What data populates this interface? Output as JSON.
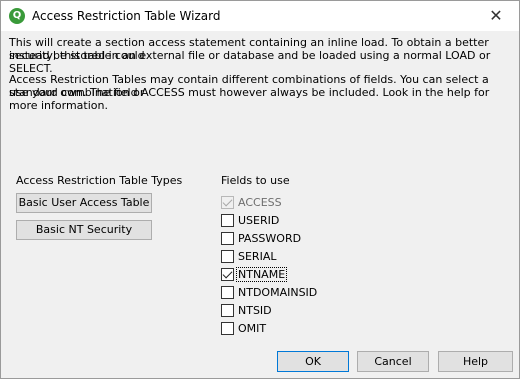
{
  "window": {
    "title": "Access Restriction Table Wizard",
    "close_glyph": "✕",
    "app_icon_letter": "Q"
  },
  "intro": {
    "line1": "This will create a section access statement containing an inline load. To obtain a better security, this table could",
    "line2": "instead be stored in an external file or database and be loaded using a normal LOAD or SELECT.",
    "line3": "Access Restriction Tables may contain different combinations of fields. You can select a standard combination or",
    "line4": "use your own. The field ACCESS must however always be included. Look in the help for more information."
  },
  "types": {
    "heading": "Access Restriction Table Types",
    "basic_user_btn": "Basic User Access Table",
    "basic_nt_btn": "Basic NT Security"
  },
  "fields": {
    "heading": "Fields to use",
    "items": [
      {
        "label": "ACCESS",
        "checked": true,
        "disabled": true
      },
      {
        "label": "USERID",
        "checked": false,
        "disabled": false
      },
      {
        "label": "PASSWORD",
        "checked": false,
        "disabled": false
      },
      {
        "label": "SERIAL",
        "checked": false,
        "disabled": false
      },
      {
        "label": "NTNAME",
        "checked": true,
        "disabled": false
      },
      {
        "label": "NTDOMAINSID",
        "checked": false,
        "disabled": false
      },
      {
        "label": "NTSID",
        "checked": false,
        "disabled": false
      },
      {
        "label": "OMIT",
        "checked": false,
        "disabled": false
      }
    ]
  },
  "footer": {
    "ok_label": "OK",
    "cancel_label": "Cancel",
    "help_label": "Help"
  },
  "colors": {
    "app_icon": "#3a9a3a",
    "dialog_bg": "#f0f0f0",
    "button_bg": "#e1e1e1"
  }
}
